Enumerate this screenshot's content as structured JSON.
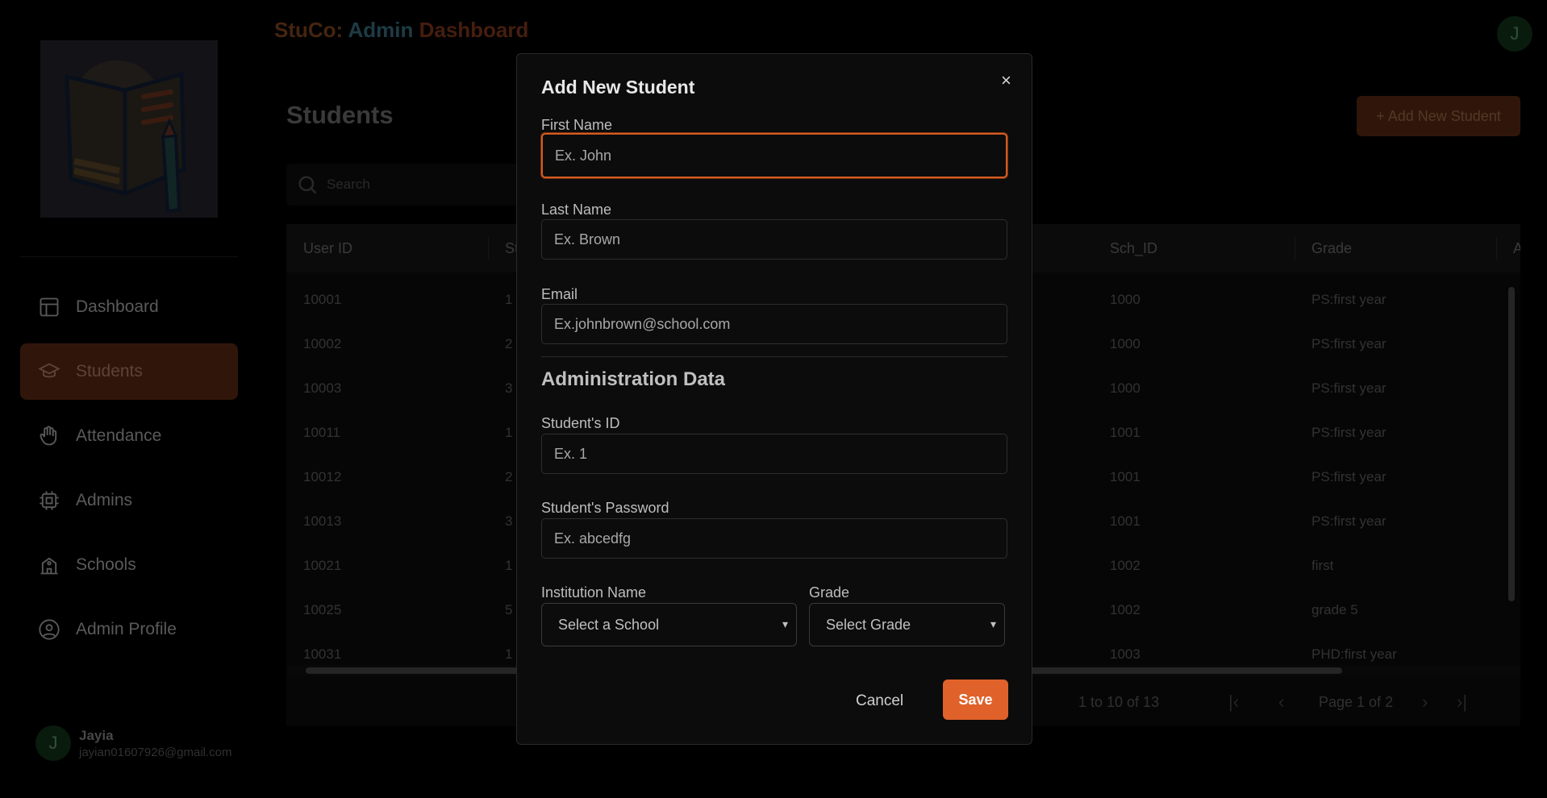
{
  "app": {
    "brand_part1": "StuCo: ",
    "brand_part2": "Admin ",
    "brand_part3": "Dashboard",
    "top_avatar_letter": "J"
  },
  "sidebar": {
    "items": [
      {
        "label": "Dashboard",
        "icon": "layout-icon"
      },
      {
        "label": "Students",
        "icon": "graduation-cap-icon",
        "active": true
      },
      {
        "label": "Attendance",
        "icon": "hand-icon"
      },
      {
        "label": "Admins",
        "icon": "cpu-icon"
      },
      {
        "label": "Schools",
        "icon": "school-icon"
      },
      {
        "label": "Admin Profile",
        "icon": "user-circle-icon"
      }
    ],
    "user": {
      "avatar_letter": "J",
      "name": "Jayia",
      "email": "jayian01607926@gmail.com"
    }
  },
  "main": {
    "title": "Students",
    "add_button": "+ Add New Student",
    "search_placeholder": "Search",
    "table": {
      "headers": [
        "User ID",
        "St",
        "Sch_ID",
        "Grade",
        "A"
      ],
      "rows": [
        [
          "10001",
          "1",
          "1000",
          "PS:first year"
        ],
        [
          "10002",
          "2",
          "1000",
          "PS:first year"
        ],
        [
          "10003",
          "3",
          "1000",
          "PS:first year"
        ],
        [
          "10011",
          "1",
          "1001",
          "PS:first year"
        ],
        [
          "10012",
          "2",
          "1001",
          "PS:first year"
        ],
        [
          "10013",
          "3",
          "1001",
          "PS:first year"
        ],
        [
          "10021",
          "1",
          "1002",
          "first"
        ],
        [
          "10025",
          "5",
          "1002",
          "grade 5"
        ],
        [
          "10031",
          "1",
          "1003",
          "PHD:first year"
        ]
      ]
    },
    "pager": {
      "range": "1 to 10 of 13",
      "page": "Page 1 of 2"
    }
  },
  "modal": {
    "title": "Add New Student",
    "close": "×",
    "first_name_label": "First Name",
    "first_name_placeholder": "Ex. John",
    "last_name_label": "Last Name",
    "last_name_placeholder": "Ex. Brown",
    "email_label": "Email",
    "email_placeholder": "Ex.johnbrown@school.com",
    "section_title": "Administration Data",
    "student_id_label": "Student's ID",
    "student_id_placeholder": "Ex. 1",
    "password_label": "Student's Password",
    "password_placeholder": "Ex. abcedfg",
    "institution_label": "Institution Name",
    "institution_value": "Select a School",
    "grade_label": "Grade",
    "grade_value": "Select Grade",
    "cancel": "Cancel",
    "save": "Save"
  },
  "colors": {
    "accent": "#e0622a",
    "active_nav_bg": "#4a2310"
  }
}
